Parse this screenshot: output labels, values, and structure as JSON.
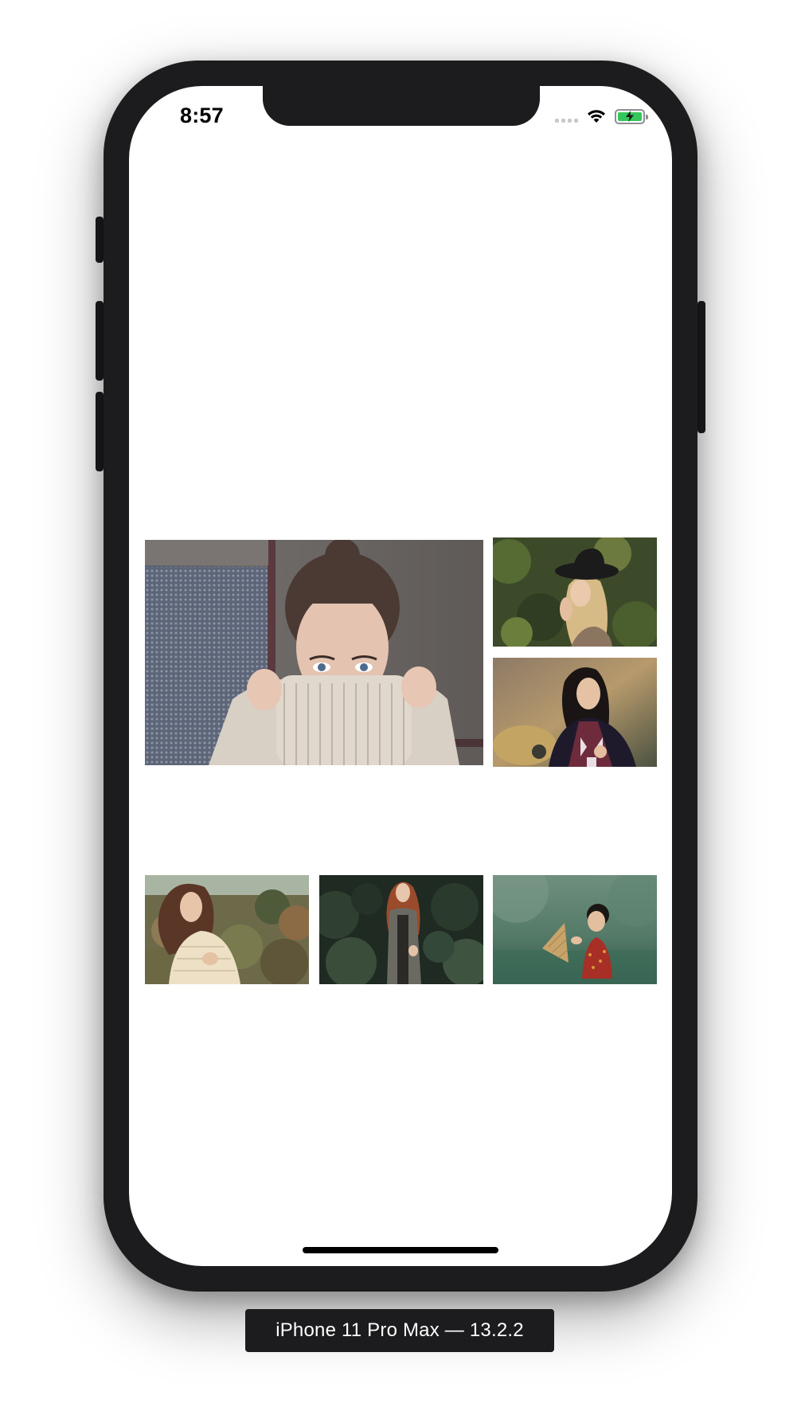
{
  "status_bar": {
    "time": "8:57",
    "signal_icon": "cellular-signal-icon",
    "wifi_icon": "wifi-icon",
    "battery_icon": "battery-charging-icon",
    "battery_color": "#34c759"
  },
  "gallery": {
    "photos": [
      {
        "id": "photo-1",
        "description": "woman pulling knit sweater over face"
      },
      {
        "id": "photo-2",
        "description": "woman in black hat among leaves"
      },
      {
        "id": "photo-3",
        "description": "woman in patterned scarf"
      },
      {
        "id": "photo-4",
        "description": "woman in cream shawl outdoors"
      },
      {
        "id": "photo-5",
        "description": "red-haired woman in forest"
      },
      {
        "id": "photo-6",
        "description": "woman with woven hat in water"
      }
    ]
  },
  "device_label": "iPhone 11 Pro Max — 13.2.2"
}
